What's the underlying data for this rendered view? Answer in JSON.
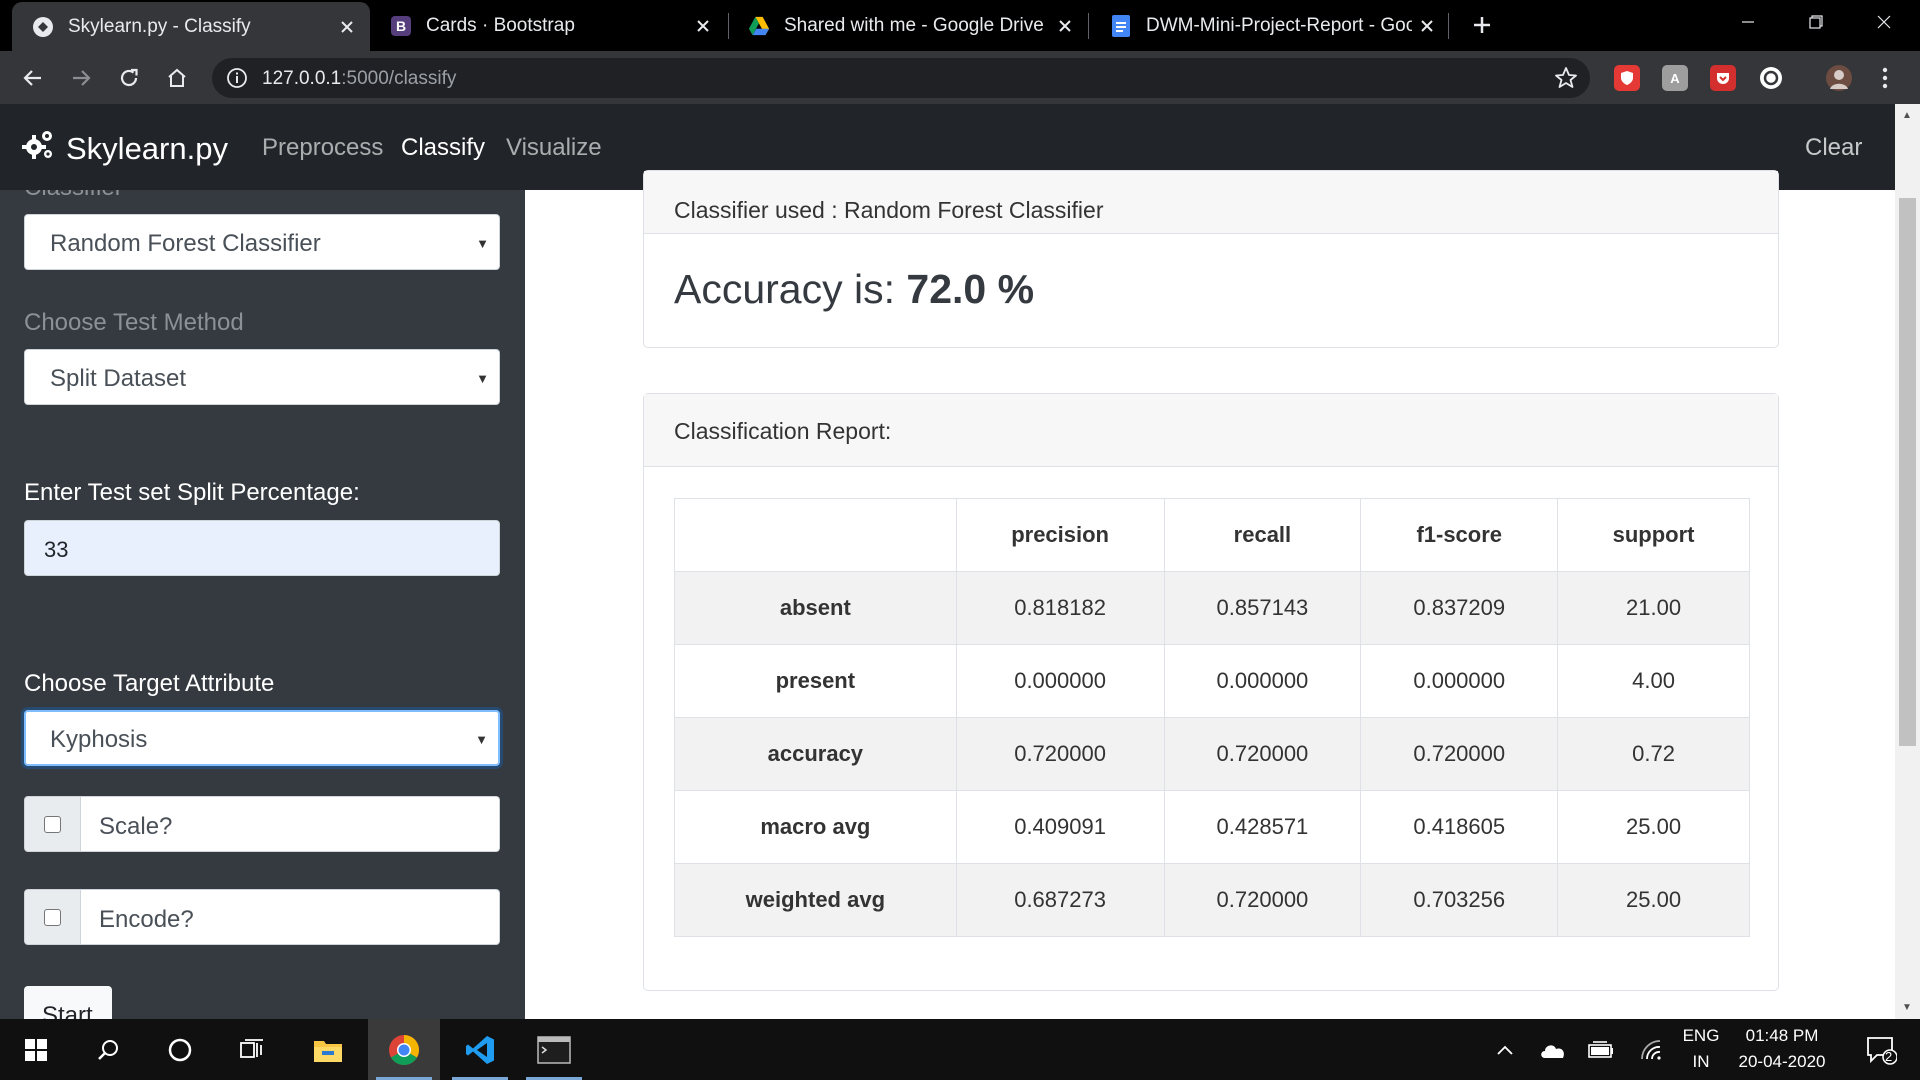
{
  "browser": {
    "tabs": [
      {
        "title": "Skylearn.py - Classify",
        "icon": "globe-icon",
        "active": true
      },
      {
        "title": "Cards · Bootstrap",
        "icon": "bootstrap-icon",
        "active": false
      },
      {
        "title": "Shared with me - Google Drive",
        "icon": "google-drive-icon",
        "active": false
      },
      {
        "title": "DWM-Mini-Project-Report - Goo",
        "icon": "google-docs-icon",
        "active": false
      }
    ],
    "url_host": "127.0.0.1",
    "url_rest": ":5000/classify"
  },
  "navbar": {
    "brand": "Skylearn.py",
    "links": [
      "Preprocess",
      "Classify",
      "Visualize"
    ],
    "active_link": "Classify",
    "clear": "Clear"
  },
  "sidebar": {
    "classifier_label_partial": "Classifier",
    "classifier_value": "Random Forest Classifier",
    "test_method_label": "Choose Test Method",
    "test_method_value": "Split Dataset",
    "split_label": "Enter Test set Split Percentage:",
    "split_value": "33",
    "target_label": "Choose Target Attribute",
    "target_value": "Kyphosis",
    "scale_label": "Scale?",
    "scale_checked": false,
    "encode_label": "Encode?",
    "encode_checked": false,
    "start_label": "Start"
  },
  "main": {
    "classifier_used": "Classifier used : Random Forest Classifier",
    "accuracy_prefix": "Accuracy is:",
    "accuracy_value": "72.0 %",
    "report_title": "Classification Report:",
    "report": {
      "columns": [
        "",
        "precision",
        "recall",
        "f1-score",
        "support"
      ],
      "rows": [
        {
          "label": "absent",
          "values": [
            "0.818182",
            "0.857143",
            "0.837209",
            "21.00"
          ]
        },
        {
          "label": "present",
          "values": [
            "0.000000",
            "0.000000",
            "0.000000",
            "4.00"
          ]
        },
        {
          "label": "accuracy",
          "values": [
            "0.720000",
            "0.720000",
            "0.720000",
            "0.72"
          ]
        },
        {
          "label": "macro avg",
          "values": [
            "0.409091",
            "0.428571",
            "0.418605",
            "25.00"
          ]
        },
        {
          "label": "weighted avg",
          "values": [
            "0.687273",
            "0.720000",
            "0.703256",
            "25.00"
          ]
        }
      ]
    }
  },
  "taskbar": {
    "apps": [
      "windows-start-icon",
      "search-icon",
      "cortana-icon",
      "task-view-icon",
      "file-explorer-icon",
      "chrome-icon",
      "vscode-icon",
      "terminal-icon"
    ],
    "lang_top": "ENG",
    "lang_bottom": "IN",
    "time": "01:48 PM",
    "date": "20-04-2020",
    "notification_count": "2"
  },
  "colors": {
    "navbar_bg": "#212529",
    "sidebar_bg": "#343a40",
    "chrome_dark": "#35363a",
    "focus_ring": "#80bdff"
  }
}
